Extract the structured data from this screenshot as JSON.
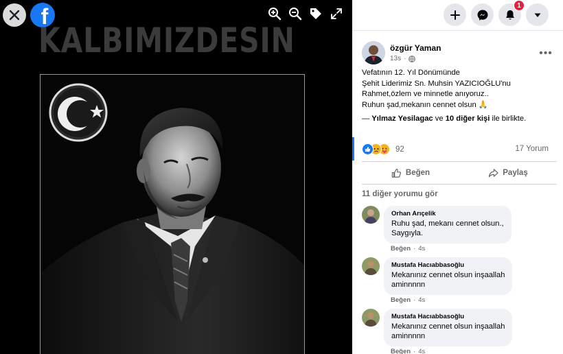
{
  "viewer": {
    "banner_text": "KALBIMIZDESIN",
    "tools": [
      "zoom-in-icon",
      "zoom-out-icon",
      "tag-icon",
      "fullscreen-icon"
    ]
  },
  "topbar": {
    "notification_count": "1"
  },
  "post": {
    "author": "özgür Yaman",
    "time": "13s",
    "text_lines": [
      "Vefatının 12. Yıl Dönümünde",
      "Şehit Liderimiz Sn. Muhsin YAZICIOĞLU'nu",
      "Rahmet,özlem ve minnetle anıyoruz..",
      "Ruhun şad,mekanın cennet olsun 🙏"
    ],
    "with_prefix": "— ",
    "with_person": "Yılmaz Yesilagac",
    "with_and": " ve ",
    "with_others": "10 diğer kişi",
    "with_suffix": " ile birlikte.",
    "reaction_count": "92",
    "comment_count": "17 Yorum",
    "like_label": "Beğen",
    "share_label": "Paylaş",
    "more_comments_label": "11 diğer yorumu gör"
  },
  "comments": [
    {
      "name": "Orhan Arıçelik",
      "lines": [
        "Ruhu şad, mekanı cennet olsun.,",
        "Saygıyla."
      ],
      "like": "Beğen",
      "time": "4s"
    },
    {
      "name": "Mustafa Hacıabbasoğlu",
      "lines": [
        "Mekanınız cennet olsun inşaallah",
        "aminnnnn"
      ],
      "like": "Beğen",
      "time": "4s"
    },
    {
      "name": "Mustafa Hacıabbasoğlu",
      "lines": [
        "Mekanınız cennet olsun inşaallah",
        "aminnnnn"
      ],
      "like": "Beğen",
      "time": "4s"
    }
  ],
  "colors": {
    "facebook_blue": "#1877f2",
    "badge_red": "#e41e3f",
    "secondary_text": "#65676b",
    "bubble_bg": "#f0f2f5"
  }
}
